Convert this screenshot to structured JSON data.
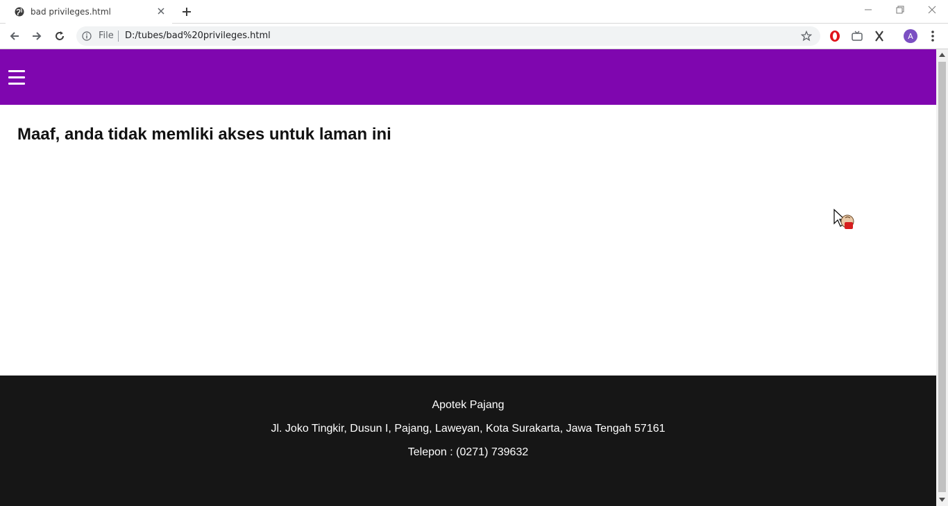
{
  "browser": {
    "tab_title": "bad privileges.html",
    "scheme_label": "File",
    "url": "D:/tubes/bad%20privileges.html",
    "profile_initial": "A",
    "accent": "#7b4fc2"
  },
  "page": {
    "navbar_color": "#7f06af",
    "menu_icon": "hamburger-icon",
    "message": "Maaf, anda tidak memliki akses untuk laman ini",
    "footer": {
      "name": "Apotek Pajang",
      "address": "Jl. Joko Tingkir, Dusun I, Pajang, Laweyan, Kota Surakarta, Jawa Tengah 57161",
      "phone": "Telepon : (0271) 739632",
      "background": "#161616"
    }
  }
}
